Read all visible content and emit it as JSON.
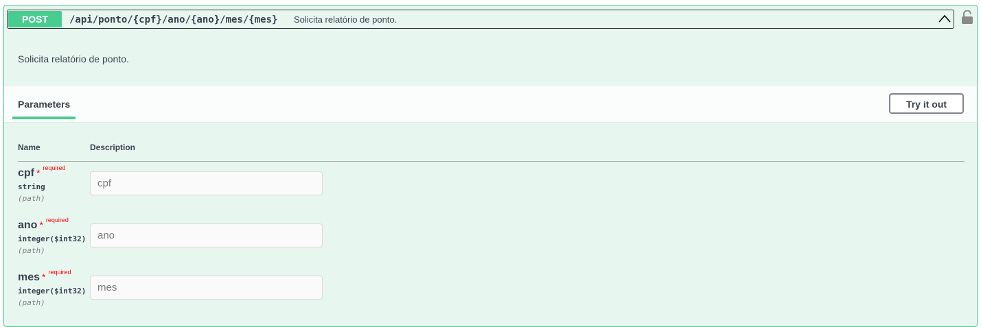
{
  "operation": {
    "method": "POST",
    "path": "/api/ponto/{cpf}/ano/{ano}/mes/{mes}",
    "summary": "Solicita relatório de ponto.",
    "description": "Solicita relatório de ponto."
  },
  "parameters_section": {
    "tab_label": "Parameters",
    "try_button_label": "Try it out",
    "col_name": "Name",
    "col_description": "Description"
  },
  "parameters": [
    {
      "name": "cpf",
      "required_star": "*",
      "required_label": "required",
      "type": "string",
      "in": "(path)",
      "placeholder": "cpf"
    },
    {
      "name": "ano",
      "required_star": "*",
      "required_label": "required",
      "type": "integer($int32)",
      "in": "(path)",
      "placeholder": "ano"
    },
    {
      "name": "mes",
      "required_star": "*",
      "required_label": "required",
      "type": "integer($int32)",
      "in": "(path)",
      "placeholder": "mes"
    }
  ],
  "icons": {
    "collapse": "chevron-up-icon",
    "auth": "unlocked-padlock-icon"
  },
  "colors": {
    "post_accent": "#49cc90",
    "block_background": "#e8f6f0",
    "required": "#ff0000"
  }
}
